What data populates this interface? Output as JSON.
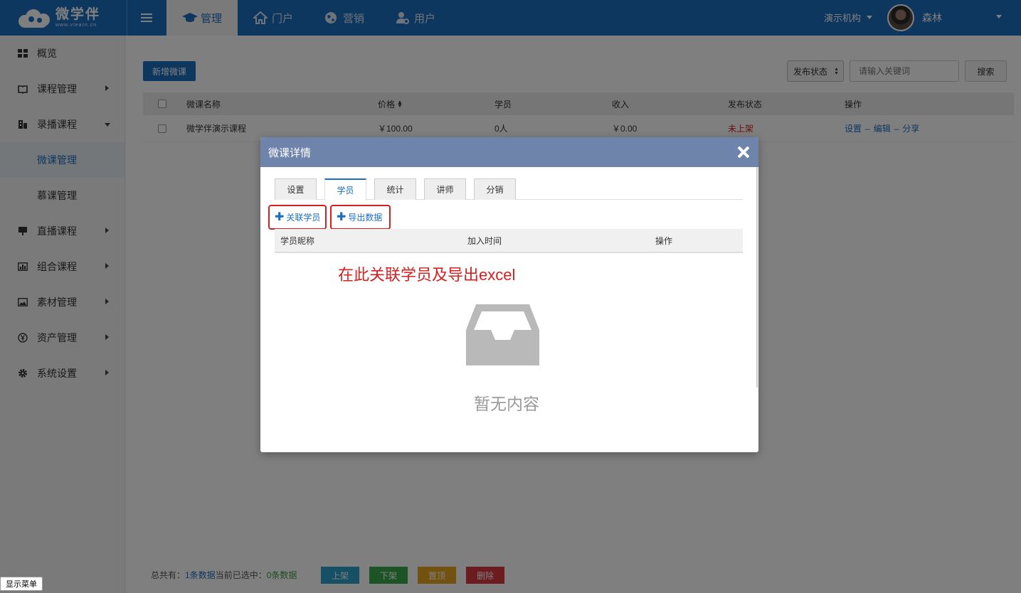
{
  "header": {
    "logo_cn": "微学伴",
    "logo_en": "www.vlearn.cn",
    "nav": [
      {
        "label": "管理",
        "icon": "graduation-cap-icon"
      },
      {
        "label": "门户",
        "icon": "home-icon"
      },
      {
        "label": "营销",
        "icon": "globe-icon"
      },
      {
        "label": "用户",
        "icon": "user-gear-icon"
      }
    ],
    "org": "演示机构",
    "username": "森林"
  },
  "sidebar": {
    "items": [
      {
        "label": "概览",
        "icon": "grid-icon"
      },
      {
        "label": "课程管理",
        "icon": "book-icon"
      },
      {
        "label": "录播课程",
        "icon": "building-icon"
      },
      {
        "label": "微课管理"
      },
      {
        "label": "慕课管理"
      },
      {
        "label": "直播课程",
        "icon": "presentation-icon"
      },
      {
        "label": "组合课程",
        "icon": "bar-chart-icon"
      },
      {
        "label": "素材管理",
        "icon": "image-icon"
      },
      {
        "label": "资产管理",
        "icon": "yen-icon"
      },
      {
        "label": "系统设置",
        "icon": "gear-icon"
      }
    ]
  },
  "main": {
    "new_button": "新增微课",
    "status_select": "发布状态",
    "search_placeholder": "请输入关键词",
    "search_button": "搜索",
    "columns": [
      "微课名称",
      "价格",
      "学员",
      "收入",
      "发布状态",
      "操作"
    ],
    "rows": [
      {
        "name": "微学伴演示课程",
        "price": "￥100.00",
        "students": "0人",
        "income": "￥0.00",
        "status": "未上架",
        "ops": [
          "设置",
          "编辑",
          "分享"
        ]
      }
    ],
    "footer": {
      "total_label": "总共有：",
      "total_value": "1条数据",
      "selected_label": "当前已选中：",
      "selected_value": "0条数据",
      "buttons": [
        {
          "label": "上架",
          "color": "#2aa0c8"
        },
        {
          "label": "下架",
          "color": "#3aa94a"
        },
        {
          "label": "置顶",
          "color": "#e6a41e"
        },
        {
          "label": "删除",
          "color": "#d9363e"
        }
      ]
    }
  },
  "modal": {
    "title": "微课详情",
    "tabs": [
      "设置",
      "学员",
      "统计",
      "讲师",
      "分销"
    ],
    "active_tab": "学员",
    "link_student": "关联学员",
    "export_data": "导出数据",
    "columns": [
      "学员昵称",
      "加入时间",
      "操作"
    ],
    "annotation": "在此关联学员及导出excel",
    "empty_text": "暂无内容"
  },
  "show_menu": "显示菜单",
  "colors": {
    "primary": "#1c6ec0",
    "modal_header": "#6f84ab",
    "danger": "#d42020"
  }
}
